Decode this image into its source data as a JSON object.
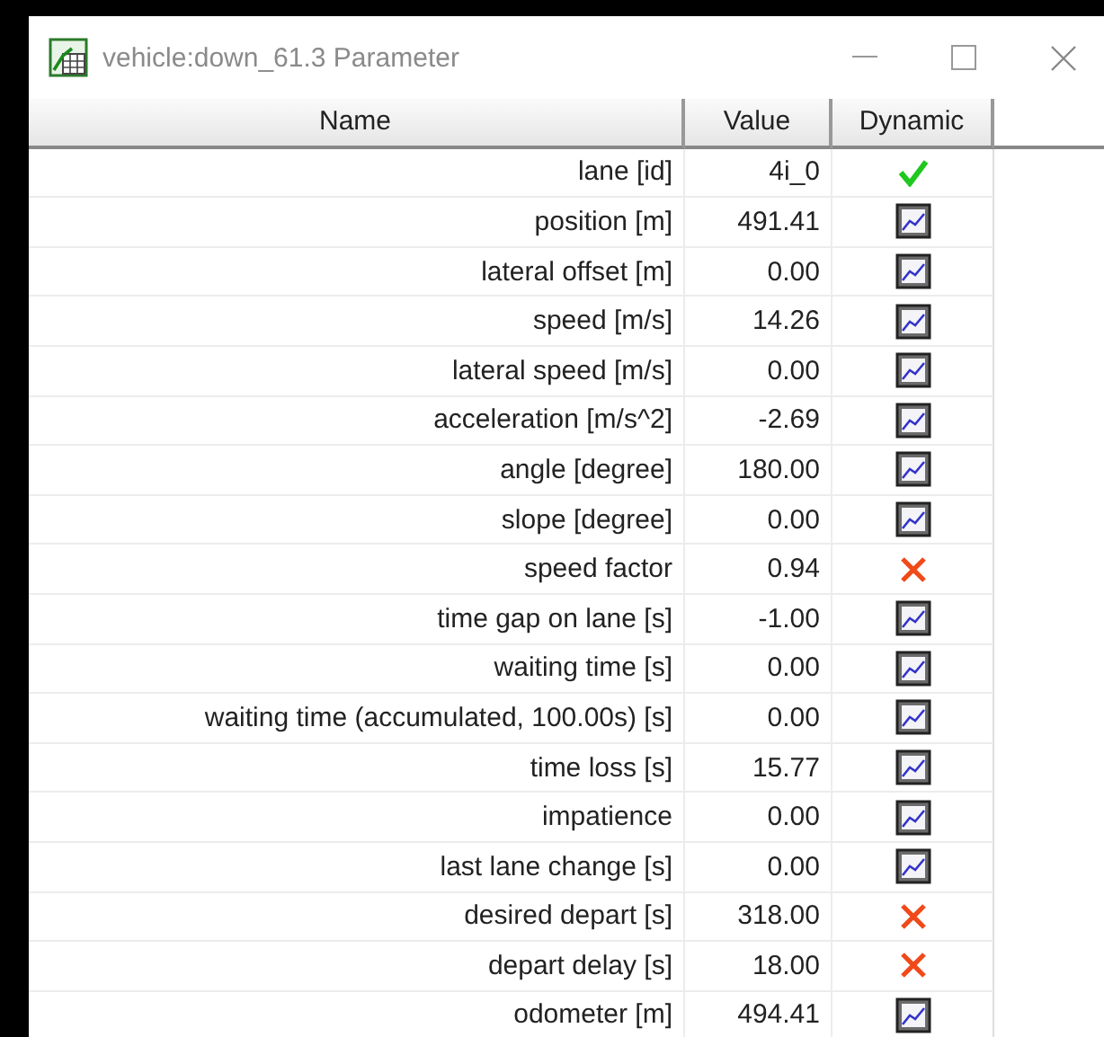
{
  "window": {
    "title": "vehicle:down_61.3 Parameter"
  },
  "table": {
    "columns": [
      "Name",
      "Value",
      "Dynamic"
    ],
    "rows": [
      {
        "name": "lane [id]",
        "value": "4i_0",
        "kind": "check"
      },
      {
        "name": "position [m]",
        "value": "491.41",
        "kind": "plot"
      },
      {
        "name": "lateral offset [m]",
        "value": "0.00",
        "kind": "plot"
      },
      {
        "name": "speed [m/s]",
        "value": "14.26",
        "kind": "plot"
      },
      {
        "name": "lateral speed [m/s]",
        "value": "0.00",
        "kind": "plot"
      },
      {
        "name": "acceleration [m/s^2]",
        "value": "-2.69",
        "kind": "plot"
      },
      {
        "name": "angle [degree]",
        "value": "180.00",
        "kind": "plot"
      },
      {
        "name": "slope [degree]",
        "value": "0.00",
        "kind": "plot"
      },
      {
        "name": "speed factor",
        "value": "0.94",
        "kind": "cross"
      },
      {
        "name": "time gap on lane [s]",
        "value": "-1.00",
        "kind": "plot"
      },
      {
        "name": "waiting time [s]",
        "value": "0.00",
        "kind": "plot"
      },
      {
        "name": "waiting time (accumulated, 100.00s) [s]",
        "value": "0.00",
        "kind": "plot"
      },
      {
        "name": "time loss [s]",
        "value": "15.77",
        "kind": "plot"
      },
      {
        "name": "impatience",
        "value": "0.00",
        "kind": "plot"
      },
      {
        "name": "last lane change [s]",
        "value": "0.00",
        "kind": "plot"
      },
      {
        "name": "desired depart [s]",
        "value": "318.00",
        "kind": "cross"
      },
      {
        "name": "depart delay [s]",
        "value": "18.00",
        "kind": "cross"
      },
      {
        "name": "odometer [m]",
        "value": "494.41",
        "kind": "plot"
      }
    ]
  }
}
